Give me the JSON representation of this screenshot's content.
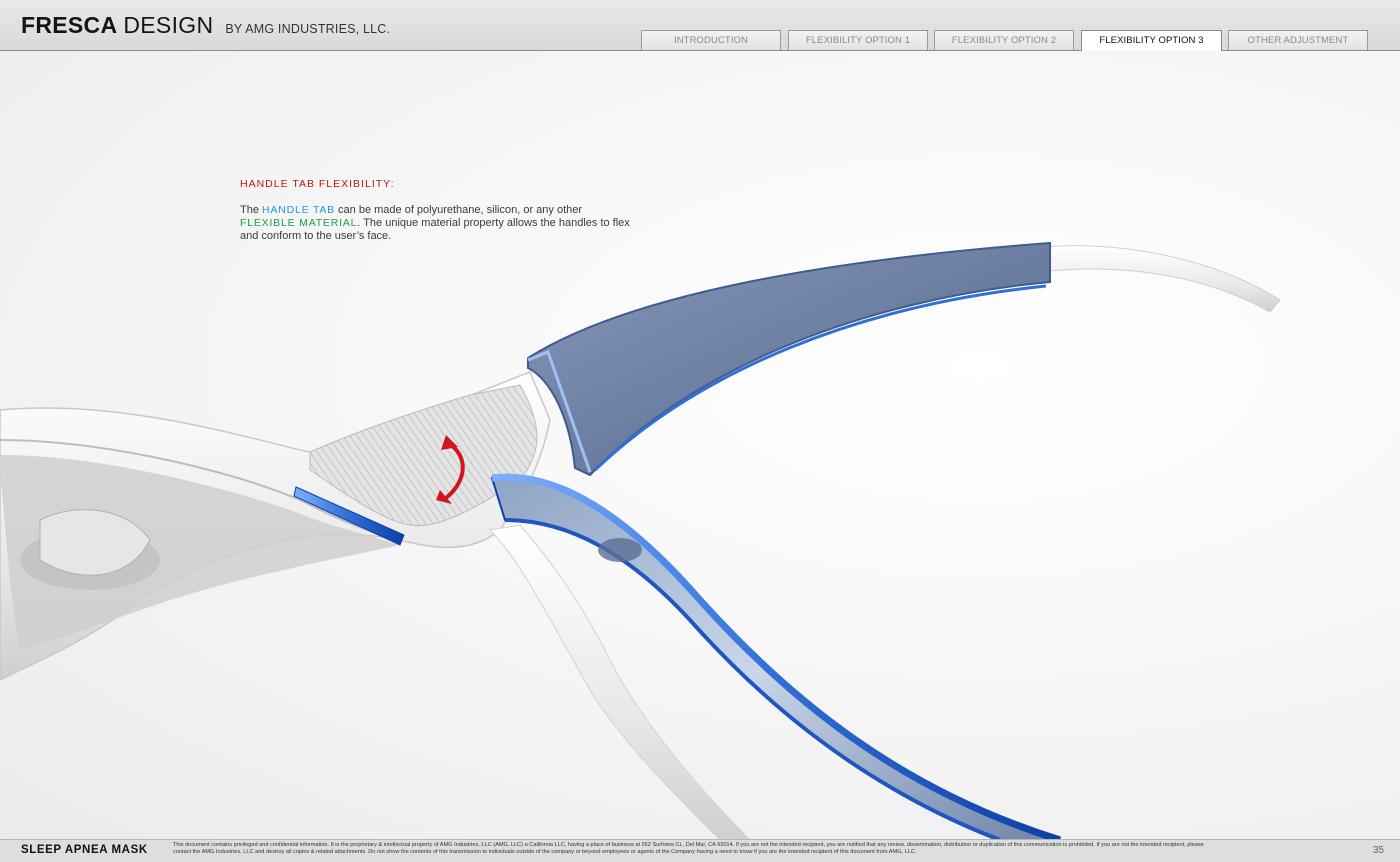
{
  "header": {
    "brand_bold": "FRESCA",
    "brand_light": "DESIGN",
    "brand_by": "BY AMG INDUSTRIES, LLC.",
    "tabs": [
      {
        "label": "INTRODUCTION",
        "active": false
      },
      {
        "label": "FLEXIBILITY OPTION 1",
        "active": false
      },
      {
        "label": "FLEXIBILITY OPTION 2",
        "active": false
      },
      {
        "label": "FLEXIBILITY OPTION 3",
        "active": true
      },
      {
        "label": "OTHER ADJUSTMENT",
        "active": false
      }
    ]
  },
  "callout": {
    "title": "HANDLE TAB FLEXIBILITY:",
    "text_1": "The ",
    "highlight_1": "HANDLE TAB",
    "text_2": " can be made of polyurethane, silicon, or any other",
    "highlight_2": "FLEXIBLE MATERIAL",
    "text_3": ". The unique material property allows the handles to flex and conform to the user’s face."
  },
  "render": {
    "description_icon": "mask-handle-render",
    "arrow_icon": "flex-arrow-icon",
    "colors": {
      "accent_blue": "#2f6fd6",
      "tab_blue_gray": "#6e84a8",
      "flex_arrow_red": "#d0161c",
      "title_red": "#c2141d",
      "highlight_blue": "#1c9ad6",
      "highlight_green": "#1aa04a"
    }
  },
  "footer": {
    "title": "SLEEP APNEA MASK",
    "legal": "This document contains privileged and confidential information. It is the proprietary & intellectual property of AMG Industries, LLC (AMG, LLC) a California LLC, having a place of business at 262 Surfview Ct., Del Mar, CA 92014. If you are not the intended recipient, you are notified that any review, dissemination, distribution or duplication of this communication is prohibited. If you are not the intended recipient, please contact the AMG Industries, LLC and destroy all copies & related attachments. Do not show the contents of this transmission to individuals outside of the company or beyond employees or agents of the Company having a need to know if you are the intended recipient of this document from AMG, LLC.",
    "page_number": "35"
  }
}
